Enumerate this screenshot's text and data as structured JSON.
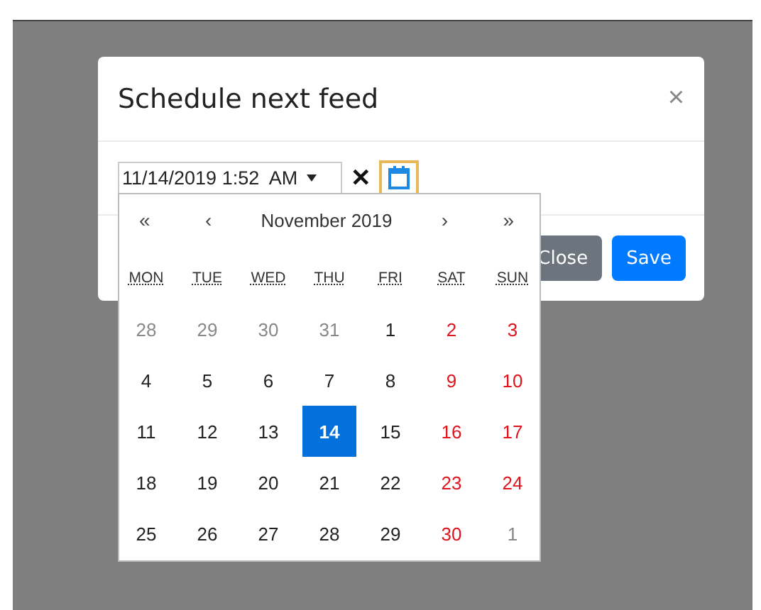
{
  "modal": {
    "title": "Schedule next feed",
    "close_glyph": "×"
  },
  "picker": {
    "value": "11/14/2019 1:52  AM",
    "clear_glyph": "✕"
  },
  "footer": {
    "buttons": [
      {
        "label": "Close",
        "kind": "secondary"
      },
      {
        "label": "Save",
        "kind": "primary"
      }
    ]
  },
  "calendar": {
    "prev_year": "«",
    "prev_month": "‹",
    "month": "November 2019",
    "next_month": "›",
    "next_year": "»",
    "weekdays": [
      "MON",
      "TUE",
      "WED",
      "THU",
      "FRI",
      "SAT",
      "SUN"
    ],
    "weeks": [
      [
        {
          "day": "28",
          "kind": "other",
          "selected": false
        },
        {
          "day": "29",
          "kind": "other",
          "selected": false
        },
        {
          "day": "30",
          "kind": "other",
          "selected": false
        },
        {
          "day": "31",
          "kind": "other",
          "selected": false
        },
        {
          "day": "1",
          "kind": "normal",
          "selected": false
        },
        {
          "day": "2",
          "kind": "weekend",
          "selected": false
        },
        {
          "day": "3",
          "kind": "weekend",
          "selected": false
        }
      ],
      [
        {
          "day": "4",
          "kind": "normal",
          "selected": false
        },
        {
          "day": "5",
          "kind": "normal",
          "selected": false
        },
        {
          "day": "6",
          "kind": "normal",
          "selected": false
        },
        {
          "day": "7",
          "kind": "normal",
          "selected": false
        },
        {
          "day": "8",
          "kind": "normal",
          "selected": false
        },
        {
          "day": "9",
          "kind": "weekend",
          "selected": false
        },
        {
          "day": "10",
          "kind": "weekend",
          "selected": false
        }
      ],
      [
        {
          "day": "11",
          "kind": "normal",
          "selected": false
        },
        {
          "day": "12",
          "kind": "normal",
          "selected": false
        },
        {
          "day": "13",
          "kind": "normal",
          "selected": false
        },
        {
          "day": "14",
          "kind": "normal",
          "selected": true
        },
        {
          "day": "15",
          "kind": "normal",
          "selected": false
        },
        {
          "day": "16",
          "kind": "weekend",
          "selected": false
        },
        {
          "day": "17",
          "kind": "weekend",
          "selected": false
        }
      ],
      [
        {
          "day": "18",
          "kind": "normal",
          "selected": false
        },
        {
          "day": "19",
          "kind": "normal",
          "selected": false
        },
        {
          "day": "20",
          "kind": "normal",
          "selected": false
        },
        {
          "day": "21",
          "kind": "normal",
          "selected": false
        },
        {
          "day": "22",
          "kind": "normal",
          "selected": false
        },
        {
          "day": "23",
          "kind": "weekend",
          "selected": false
        },
        {
          "day": "24",
          "kind": "weekend",
          "selected": false
        }
      ],
      [
        {
          "day": "25",
          "kind": "normal",
          "selected": false
        },
        {
          "day": "26",
          "kind": "normal",
          "selected": false
        },
        {
          "day": "27",
          "kind": "normal",
          "selected": false
        },
        {
          "day": "28",
          "kind": "normal",
          "selected": false
        },
        {
          "day": "29",
          "kind": "normal",
          "selected": false
        },
        {
          "day": "30",
          "kind": "weekend",
          "selected": false
        },
        {
          "day": "1",
          "kind": "other",
          "selected": false
        }
      ]
    ]
  }
}
